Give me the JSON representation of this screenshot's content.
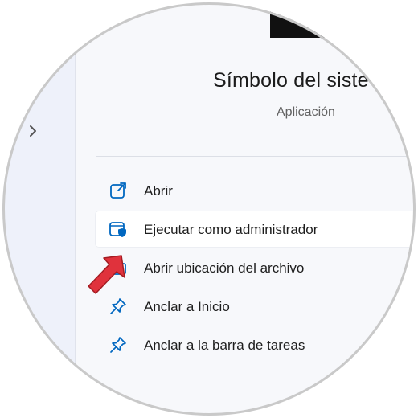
{
  "app": {
    "title": "Símbolo del siste",
    "subtitle": "Aplicación"
  },
  "nav": {
    "expand_icon": "chevron-right-icon"
  },
  "menu": [
    {
      "label": "Abrir",
      "icon": "open-external-icon"
    },
    {
      "label": "Ejecutar como administrador",
      "icon": "run-as-admin-shield-icon",
      "hovered": true
    },
    {
      "label": "Abrir ubicación del archivo",
      "icon": "folder-icon"
    },
    {
      "label": "Anclar a Inicio",
      "icon": "pin-icon"
    },
    {
      "label": "Anclar a la barra de tareas",
      "icon": "pin-icon"
    }
  ],
  "annotation": {
    "arrow_color": "#e0323c",
    "pointer_icon": "red-arrow-pointer-icon"
  },
  "colors": {
    "accent": "#0067c0",
    "text": "#1e1e1e",
    "subtext": "#616161"
  }
}
